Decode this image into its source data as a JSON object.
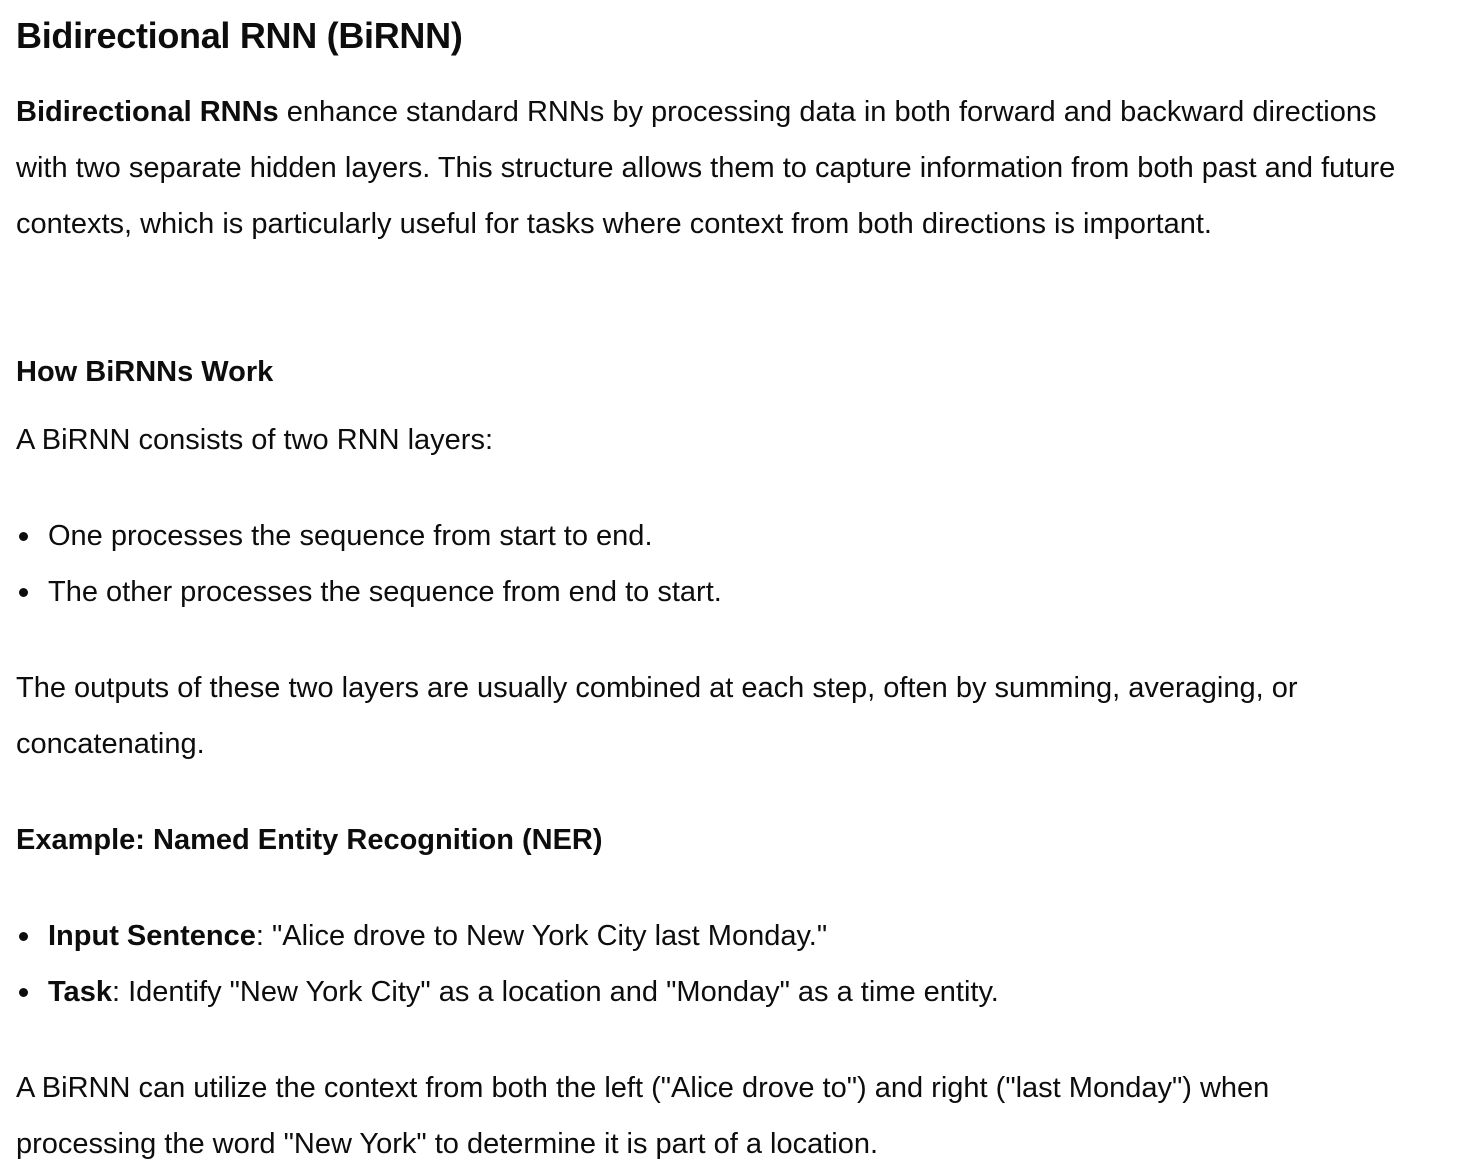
{
  "title": "Bidirectional RNN (BiRNN)",
  "intro": {
    "bold": "Bidirectional RNNs",
    "text": " enhance standard RNNs by processing data in both forward and backward directions with two separate hidden layers. This structure allows them to capture information from both past and future contexts, which is particularly useful for tasks where context from both directions is important."
  },
  "how_heading": "How BiRNNs Work",
  "how_intro": "A BiRNN consists of two RNN layers:",
  "how_bullets": [
    "One processes the sequence from start to end.",
    "The other processes the sequence from end to start."
  ],
  "outputs_para": "The outputs of these two layers are usually combined at each step, often by summing, averaging, or concatenating.",
  "example_heading": "Example: Named Entity Recognition (NER)",
  "example_bullets": [
    {
      "bold": "Input Sentence",
      "text": ": \"Alice drove to New York City last Monday.\""
    },
    {
      "bold": "Task",
      "text": ": Identify \"New York City\" as a location and \"Monday\" as a time entity."
    }
  ],
  "closing_para": "A BiRNN can utilize the context from both the left (\"Alice drove to\") and right (\"last Monday\") when processing the word \"New York\" to determine it is part of a location."
}
